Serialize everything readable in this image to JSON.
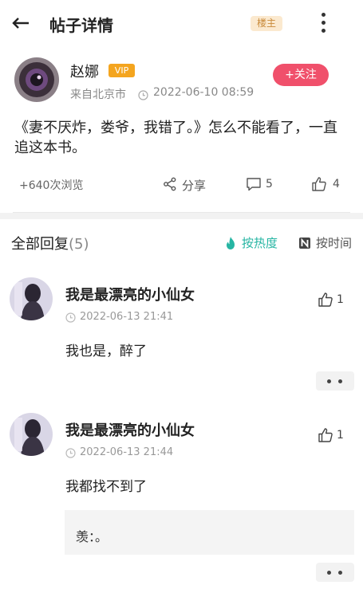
{
  "header": {
    "title": "帖子详情",
    "owner_tag": "楼主"
  },
  "post": {
    "author": {
      "name": "赵娜",
      "badge": "VIP",
      "location": "来自北京市",
      "time": "2022-06-10 08:59"
    },
    "follow_label": "+关注",
    "content": "《妻不厌炸，娄爷，我错了。》怎么不能看了，一直追这本书。",
    "views": "+640次浏览",
    "share_label": "分享",
    "comment_count": "5",
    "like_count": "4"
  },
  "replies": {
    "title": "全部回复",
    "count": "(5)",
    "sort_hot": "按热度",
    "sort_time": "按时间",
    "items": [
      {
        "name": "我是最漂亮的小仙女",
        "time": "2022-06-13 21:41",
        "likes": "1",
        "text": "我也是，醉了"
      },
      {
        "name": "我是最漂亮的小仙女",
        "time": "2022-06-13 21:44",
        "likes": "1",
        "text": "我都找不到了",
        "quote": "羡：。"
      }
    ]
  },
  "colors": {
    "follow": "#f0506b",
    "vip": "#f4a51f",
    "hot_sort": "#26b5a3",
    "owner_tag_bg": "#fbe9cf"
  },
  "icons": [
    "back-arrow-icon",
    "more-vertical-icon",
    "clock-icon",
    "share-icon",
    "comment-icon",
    "thumbs-up-icon",
    "flame-icon",
    "time-sort-icon"
  ]
}
